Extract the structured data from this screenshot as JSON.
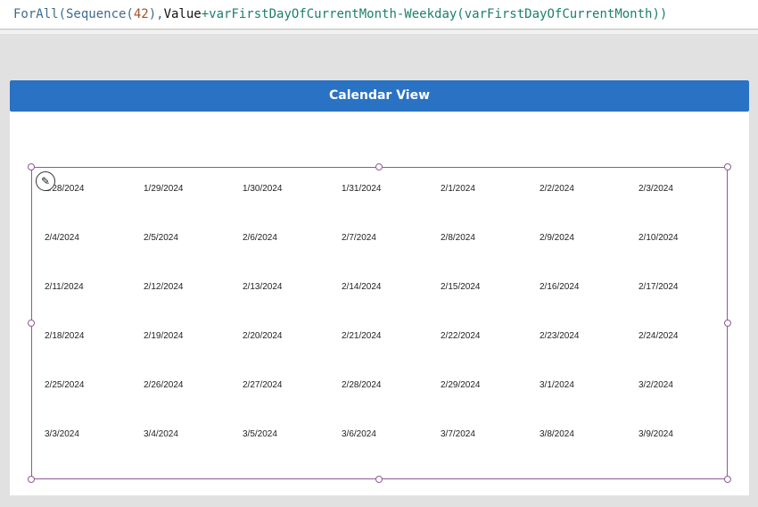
{
  "formula": {
    "parts": [
      {
        "text": "ForAll(Sequence(",
        "cls": "f-fn"
      },
      {
        "text": "42",
        "cls": "f-num"
      },
      {
        "text": "),",
        "cls": "f-fn"
      },
      {
        "text": "Value",
        "cls": "f-kw"
      },
      {
        "text": "+varFirstDayOfCurrentMonth-Weekday(varFirstDayOfCurrentMonth))",
        "cls": "f-var"
      }
    ]
  },
  "header": {
    "title": "Calendar View"
  },
  "gallery": {
    "dates": [
      "1/28/2024",
      "1/29/2024",
      "1/30/2024",
      "1/31/2024",
      "2/1/2024",
      "2/2/2024",
      "2/3/2024",
      "2/4/2024",
      "2/5/2024",
      "2/6/2024",
      "2/7/2024",
      "2/8/2024",
      "2/9/2024",
      "2/10/2024",
      "2/11/2024",
      "2/12/2024",
      "2/13/2024",
      "2/14/2024",
      "2/15/2024",
      "2/16/2024",
      "2/17/2024",
      "2/18/2024",
      "2/19/2024",
      "2/20/2024",
      "2/21/2024",
      "2/22/2024",
      "2/23/2024",
      "2/24/2024",
      "2/25/2024",
      "2/26/2024",
      "2/27/2024",
      "2/28/2024",
      "2/29/2024",
      "3/1/2024",
      "3/2/2024",
      "3/3/2024",
      "3/4/2024",
      "3/5/2024",
      "3/6/2024",
      "3/7/2024",
      "3/8/2024",
      "3/9/2024"
    ]
  }
}
